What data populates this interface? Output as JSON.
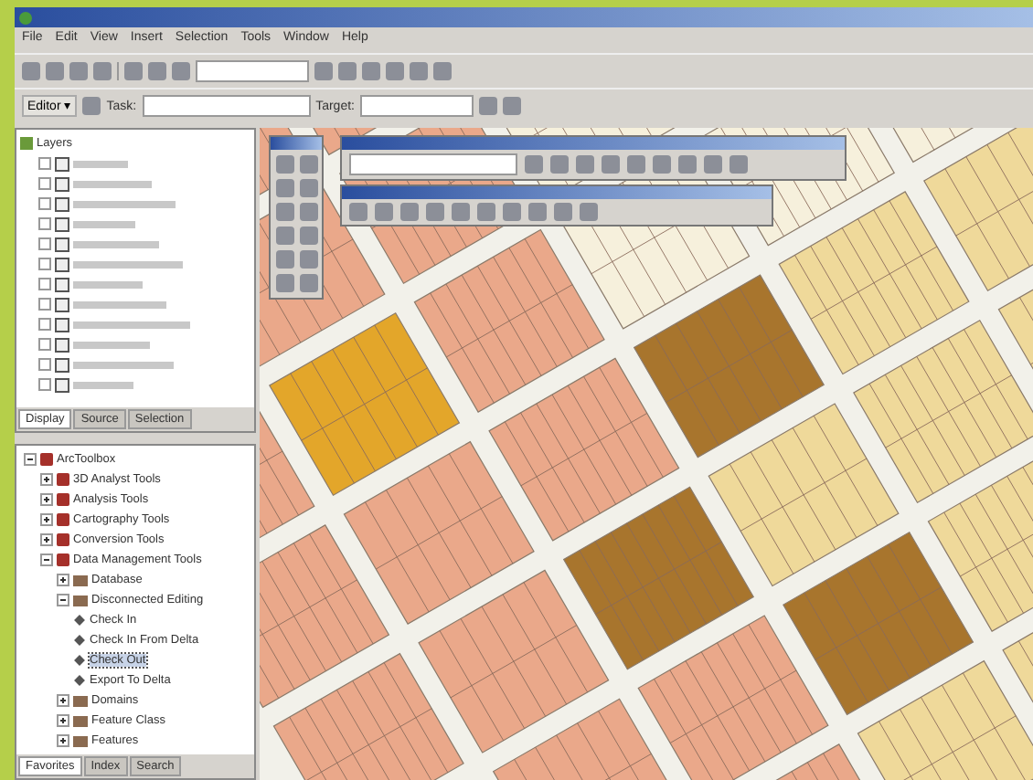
{
  "menu": [
    "File",
    "Edit",
    "View",
    "Insert",
    "Selection",
    "Tools",
    "Window",
    "Help"
  ],
  "editor_toolbar": {
    "editor": "Editor ▾",
    "task_label": "Task:",
    "target_label": "Target:"
  },
  "toc": {
    "root": "Layers",
    "tabs": [
      {
        "label": "Display",
        "selected": true
      },
      {
        "label": "Source",
        "selected": false
      },
      {
        "label": "Selection",
        "selected": false
      }
    ]
  },
  "toolbox": {
    "items": [
      {
        "label": "ArcToolbox",
        "selected": false,
        "expanded": true,
        "children": [
          {
            "label": "3D Analyst Tools",
            "selected": false,
            "expanded": false
          },
          {
            "label": "Analysis Tools",
            "selected": false,
            "expanded": false
          },
          {
            "label": "Cartography Tools",
            "selected": false,
            "expanded": false
          },
          {
            "label": "Conversion Tools",
            "selected": false,
            "expanded": false
          },
          {
            "label": "Data Management Tools",
            "selected": false,
            "expanded": true,
            "children": [
              {
                "label": "Database",
                "selected": false,
                "expanded": false
              },
              {
                "label": "Disconnected Editing",
                "selected": false,
                "expanded": true,
                "children": [
                  {
                    "label": "Check In",
                    "selected": false
                  },
                  {
                    "label": "Check In From Delta",
                    "selected": false
                  },
                  {
                    "label": "Check Out",
                    "selected": true
                  },
                  {
                    "label": "Export To Delta",
                    "selected": false
                  }
                ]
              },
              {
                "label": "Domains",
                "selected": false,
                "expanded": false
              },
              {
                "label": "Feature Class",
                "selected": false,
                "expanded": false
              },
              {
                "label": "Features",
                "selected": false,
                "expanded": false
              }
            ]
          }
        ]
      }
    ],
    "tabs": [
      {
        "label": "Favorites",
        "selected": true
      },
      {
        "label": "Index",
        "selected": false
      },
      {
        "label": "Search",
        "selected": false
      }
    ]
  }
}
